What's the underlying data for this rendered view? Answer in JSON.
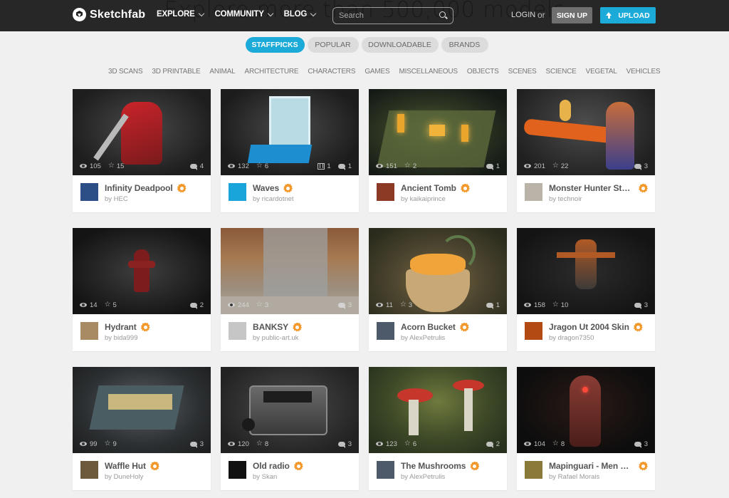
{
  "headline": "Explore more than 500,000 models",
  "navbar": {
    "brand": "Sketchfab",
    "menu": [
      {
        "label": "EXPLORE"
      },
      {
        "label": "COMMUNITY"
      },
      {
        "label": "BLOG"
      }
    ],
    "search_placeholder": "Search",
    "login_label": "LOGIN",
    "or_label": "or",
    "signup_label": "SIGN UP",
    "upload_label": "UPLOAD"
  },
  "tabs": [
    {
      "label": "STAFFPICKS",
      "active": true
    },
    {
      "label": "POPULAR",
      "active": false
    },
    {
      "label": "DOWNLOADABLE",
      "active": false
    },
    {
      "label": "BRANDS",
      "active": false
    }
  ],
  "categories": [
    "3D SCANS",
    "3D PRINTABLE",
    "ANIMAL",
    "ARCHITECTURE",
    "CHARACTERS",
    "GAMES",
    "MISCELLANEOUS",
    "OBJECTS",
    "SCENES",
    "SCIENCE",
    "VEGETAL",
    "VEHICLES"
  ],
  "colors": {
    "accent": "#1caad9",
    "badge": "#f3982a",
    "navbar": "#181818",
    "signup": "#6f6f6f"
  },
  "models": [
    {
      "title": "Infinity Deadpool",
      "author": "by HEC",
      "views": "105",
      "likes": "15",
      "comments": "4",
      "animations": null,
      "staffpick": true
    },
    {
      "title": "Waves",
      "author": "by ricardotnet",
      "views": "132",
      "likes": "6",
      "comments": "1",
      "animations": "1",
      "staffpick": true
    },
    {
      "title": "Ancient Tomb",
      "author": "by kaikaiprince",
      "views": "151",
      "likes": "2",
      "comments": "1",
      "animations": null,
      "staffpick": true
    },
    {
      "title": "Monster Hunter Stor...",
      "author": "by technoir",
      "views": "201",
      "likes": "22",
      "comments": "3",
      "animations": null,
      "staffpick": true
    },
    {
      "title": "Hydrant",
      "author": "by bida999",
      "views": "14",
      "likes": "5",
      "comments": "2",
      "animations": null,
      "staffpick": true
    },
    {
      "title": "BANKSY",
      "author": "by public-art.uk",
      "views": "244",
      "likes": "3",
      "comments": "3",
      "animations": null,
      "staffpick": true
    },
    {
      "title": "Acorn Bucket",
      "author": "by AlexPetrulis",
      "views": "11",
      "likes": "3",
      "comments": "1",
      "animations": null,
      "staffpick": true
    },
    {
      "title": "Jragon Ut 2004 Skin",
      "author": "by dragon7350",
      "views": "158",
      "likes": "10",
      "comments": "3",
      "animations": null,
      "staffpick": true
    },
    {
      "title": "Waffle Hut",
      "author": "by DuneHoly",
      "views": "99",
      "likes": "9",
      "comments": "3",
      "animations": null,
      "staffpick": true
    },
    {
      "title": "Old radio",
      "author": "by Skan",
      "views": "120",
      "likes": "8",
      "comments": "3",
      "animations": null,
      "staffpick": true
    },
    {
      "title": "The Mushrooms",
      "author": "by AlexPetrulis",
      "views": "123",
      "likes": "6",
      "comments": "2",
      "animations": null,
      "staffpick": true
    },
    {
      "title": "Mapinguari - Men Ea...",
      "author": "by Rafael Morais",
      "views": "104",
      "likes": "8",
      "comments": "3",
      "animations": null,
      "staffpick": true
    }
  ]
}
